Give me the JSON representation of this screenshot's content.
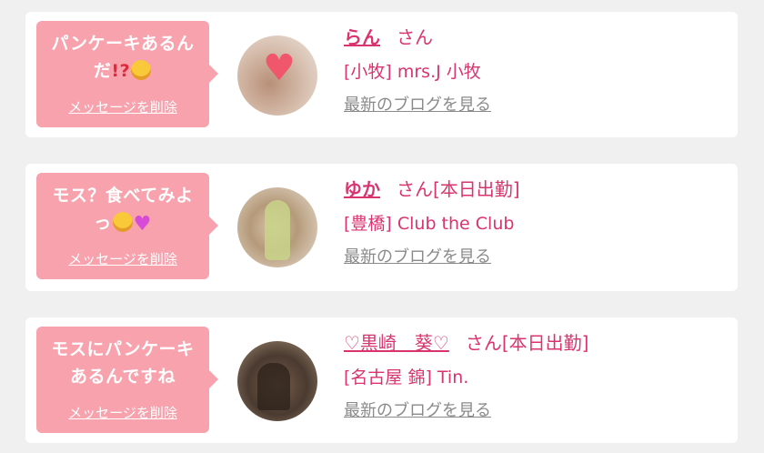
{
  "entries": [
    {
      "message": "パンケーキあるんだ",
      "message_emoji": [
        "!?",
        "laughing-face"
      ],
      "delete_label": "メッセージを削除",
      "name": "らん",
      "honorific": "さん",
      "status": "",
      "shop": "[小牧] mrs.J 小牧",
      "blog_label": "最新のブログを見る"
    },
    {
      "message": "モス？食べてみよっ",
      "message_emoji": [
        "star-struck-face",
        "pink-heart"
      ],
      "delete_label": "メッセージを削除",
      "name": "ゆか",
      "honorific": "さん",
      "status": "[本日出勤]",
      "shop": "[豊橋] Club the Club",
      "blog_label": "最新のブログを見る"
    },
    {
      "message": "モスにパンケーキあるんですね",
      "message_emoji": [],
      "delete_label": "メッセージを削除",
      "name": "♡黒崎　葵♡",
      "honorific": "さん",
      "status": "[本日出勤]",
      "shop": "[名古屋 錦] Tin.",
      "blog_label": "最新のブログを見る"
    }
  ],
  "colors": {
    "bubble": "#f7a2ad",
    "accent": "#d9346e",
    "link_gray": "#8a8a8a",
    "background": "#f0f0f0"
  }
}
